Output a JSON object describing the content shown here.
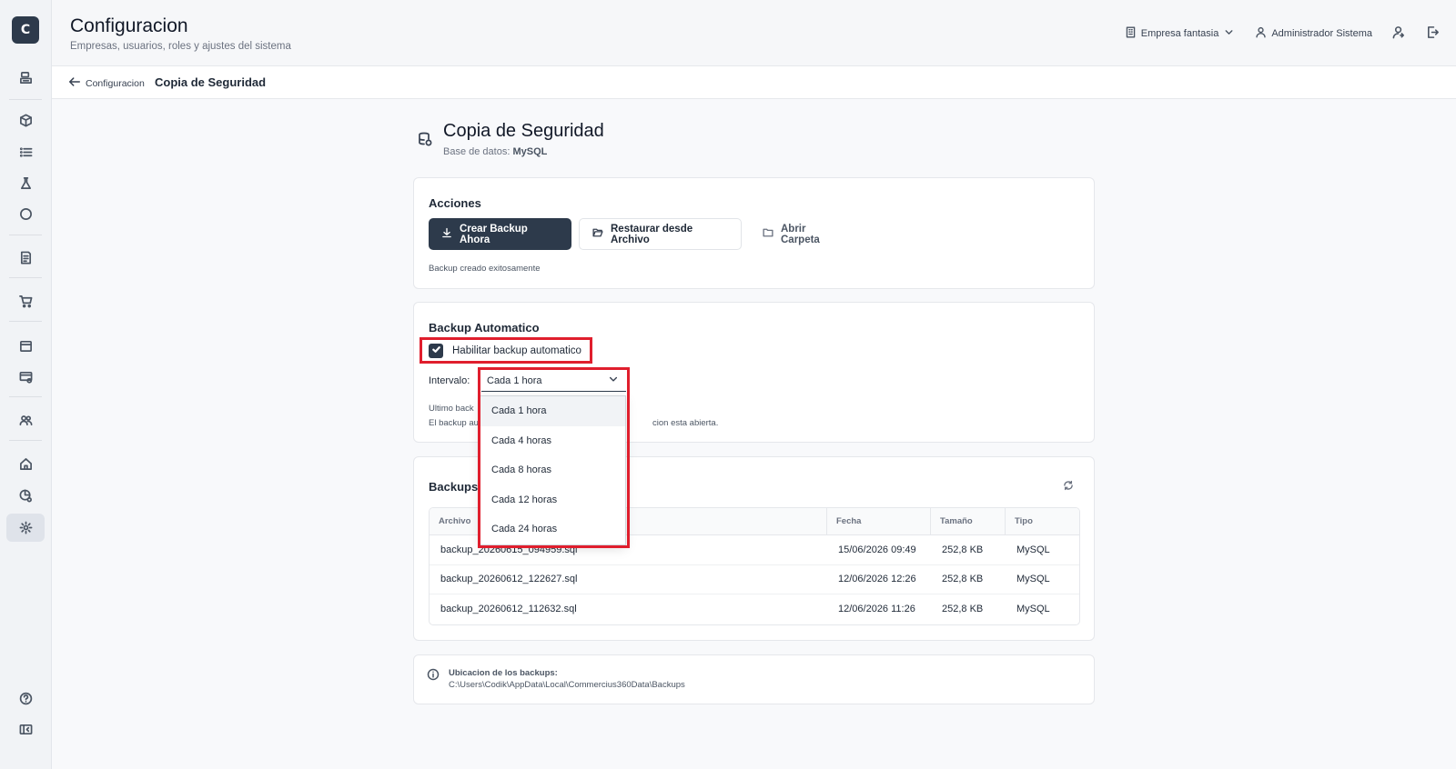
{
  "sidebar": {
    "logo_letter": "C",
    "icons": [
      "cashier-icon",
      "box-icon",
      "list-icon",
      "flask-icon",
      "circle-icon",
      "receipt-icon",
      "cart-icon",
      "calendar-icon",
      "card-settings-icon",
      "users-icon",
      "home-icon",
      "chart-settings-icon",
      "gear-icon",
      "help-icon",
      "sidebar-toggle-icon"
    ]
  },
  "header": {
    "title": "Configuracion",
    "subtitle": "Empresas, usuarios, roles y ajustes del sistema",
    "company": "Empresa fantasia",
    "user": "Administrador Sistema"
  },
  "breadcrumb": {
    "back_label": "Configuracion",
    "current": "Copia de Seguridad"
  },
  "page": {
    "title": "Copia de Seguridad",
    "db_label": "Base de datos:",
    "db_value": "MySQL"
  },
  "actions": {
    "title": "Acciones",
    "create_label": "Crear Backup Ahora",
    "restore_label": "Restaurar desde Archivo",
    "open_folder_label": "Abrir Carpeta",
    "status": "Backup creado exitosamente"
  },
  "auto": {
    "title": "Backup Automatico",
    "enable_label": "Habilitar backup automatico",
    "enabled": true,
    "interval_label": "Intervalo:",
    "interval_value": "Cada 1 hora",
    "note1": "Ultimo back",
    "note2_start": "El backup au",
    "note2_end": "cion esta abierta.",
    "options": [
      "Cada 1 hora",
      "Cada 4 horas",
      "Cada 8 horas",
      "Cada 12 horas",
      "Cada 24 horas"
    ],
    "selected_index": 0
  },
  "backups": {
    "title": "Backups",
    "headers": [
      "Archivo",
      "Fecha",
      "Tamaño",
      "Tipo"
    ],
    "rows": [
      [
        "backup_20260615_094959.sql",
        "15/06/2026 09:49",
        "252,8 KB",
        "MySQL"
      ],
      [
        "backup_20260612_122627.sql",
        "12/06/2026 12:26",
        "252,8 KB",
        "MySQL"
      ],
      [
        "backup_20260612_112632.sql",
        "12/06/2026 11:26",
        "252,8 KB",
        "MySQL"
      ]
    ]
  },
  "location": {
    "title": "Ubicacion de los backups:",
    "path": "C:\\Users\\Codik\\AppData\\Local\\Commercius360Data\\Backups"
  },
  "colors": {
    "accent": "#2d3a4b",
    "highlight": "#e01e2d"
  }
}
